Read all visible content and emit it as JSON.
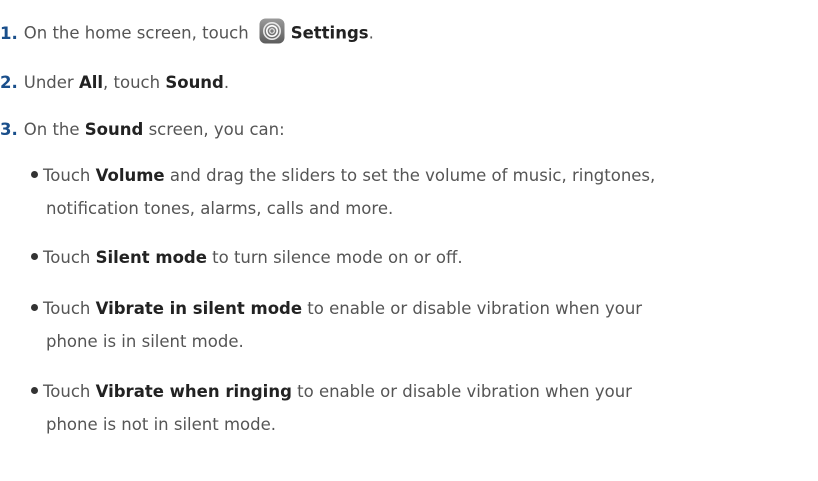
{
  "steps": [
    {
      "number": "1.",
      "text_before": "On the home screen, touch",
      "bold": "Settings",
      "text_after": ".",
      "icon": "settings-gear-icon"
    },
    {
      "number": "2.",
      "text_a": "Under",
      "bold_a": "All",
      "text_b": ", touch",
      "bold_b": "Sound",
      "text_c": "."
    },
    {
      "number": "3.",
      "text_a": "On the",
      "bold_a": "Sound",
      "text_b": "screen, you can:"
    }
  ],
  "bullets": [
    {
      "lead": "Touch",
      "bold": "Volume",
      "rest_line1": "and drag the sliders to set the volume of music, ringtones,",
      "line2": "notification tones, alarms, calls and more."
    },
    {
      "lead": "Touch",
      "bold": "Silent mode",
      "rest_line1": "to turn silence mode on or off."
    },
    {
      "lead": "Touch",
      "bold": "Vibrate in silent mode",
      "rest_line1": "to enable or disable vibration when your",
      "line2": "phone is in silent mode."
    },
    {
      "lead": "Touch",
      "bold": "Vibrate when ringing",
      "rest_line1": "to enable or disable vibration when your",
      "line2": "phone is not in silent mode."
    }
  ],
  "colors": {
    "step_number": "#1a4f8b",
    "body_text": "#555555",
    "bold_text": "#222222"
  }
}
